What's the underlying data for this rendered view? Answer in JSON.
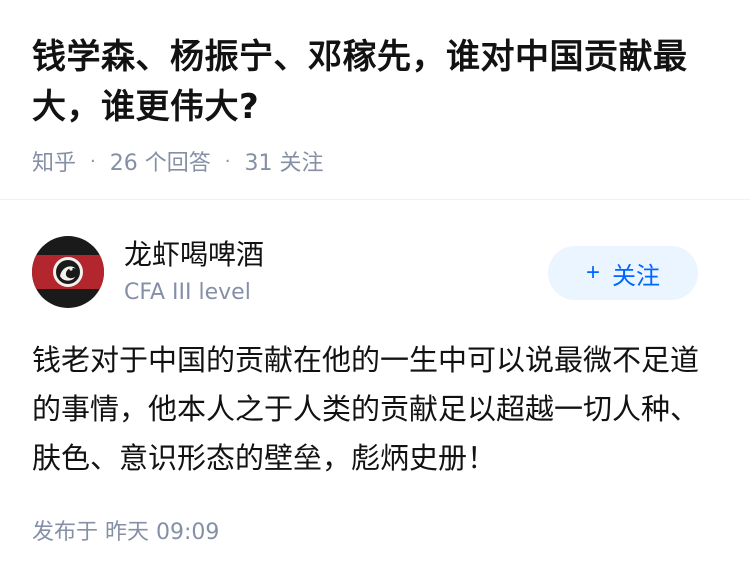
{
  "question": {
    "title": "钱学森、杨振宁、邓稼先，谁对中国贡献最大，谁更伟大?",
    "source": "知乎",
    "separator": "·",
    "answers_count": "26 个回答",
    "followers_count": "31 关注"
  },
  "answer": {
    "author": {
      "name": "龙虾喝啤酒",
      "tagline": "CFA III level",
      "avatar_icon": "logo-avatar-icon"
    },
    "follow_button": {
      "plus": "+",
      "label": "关注"
    },
    "content": "钱老对于中国的贡献在他的一生中可以说最微不足道的事情，他本人之于人类的贡献足以超越一切人种、肤色、意识形态的壁垒，彪炳史册！",
    "published": "发布于 昨天 09:09"
  },
  "colors": {
    "accent": "#0066ff",
    "follow_bg": "#ebf5ff",
    "meta": "#8590a6",
    "text": "#121212"
  }
}
